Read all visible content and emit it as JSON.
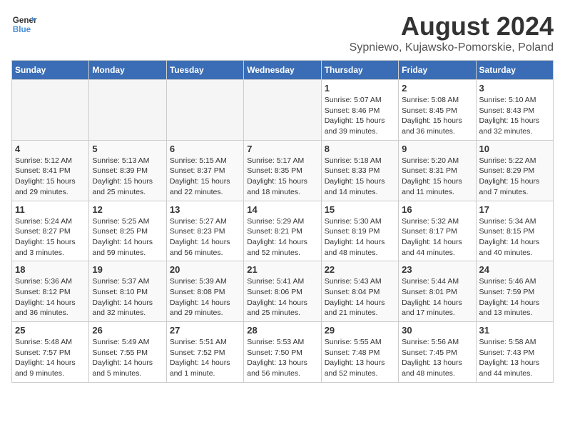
{
  "header": {
    "logo_line1": "General",
    "logo_line2": "Blue",
    "month_title": "August 2024",
    "subtitle": "Sypniewo, Kujawsko-Pomorskie, Poland"
  },
  "weekdays": [
    "Sunday",
    "Monday",
    "Tuesday",
    "Wednesday",
    "Thursday",
    "Friday",
    "Saturday"
  ],
  "weeks": [
    [
      {
        "day": "",
        "info": ""
      },
      {
        "day": "",
        "info": ""
      },
      {
        "day": "",
        "info": ""
      },
      {
        "day": "",
        "info": ""
      },
      {
        "day": "1",
        "info": "Sunrise: 5:07 AM\nSunset: 8:46 PM\nDaylight: 15 hours\nand 39 minutes."
      },
      {
        "day": "2",
        "info": "Sunrise: 5:08 AM\nSunset: 8:45 PM\nDaylight: 15 hours\nand 36 minutes."
      },
      {
        "day": "3",
        "info": "Sunrise: 5:10 AM\nSunset: 8:43 PM\nDaylight: 15 hours\nand 32 minutes."
      }
    ],
    [
      {
        "day": "4",
        "info": "Sunrise: 5:12 AM\nSunset: 8:41 PM\nDaylight: 15 hours\nand 29 minutes."
      },
      {
        "day": "5",
        "info": "Sunrise: 5:13 AM\nSunset: 8:39 PM\nDaylight: 15 hours\nand 25 minutes."
      },
      {
        "day": "6",
        "info": "Sunrise: 5:15 AM\nSunset: 8:37 PM\nDaylight: 15 hours\nand 22 minutes."
      },
      {
        "day": "7",
        "info": "Sunrise: 5:17 AM\nSunset: 8:35 PM\nDaylight: 15 hours\nand 18 minutes."
      },
      {
        "day": "8",
        "info": "Sunrise: 5:18 AM\nSunset: 8:33 PM\nDaylight: 15 hours\nand 14 minutes."
      },
      {
        "day": "9",
        "info": "Sunrise: 5:20 AM\nSunset: 8:31 PM\nDaylight: 15 hours\nand 11 minutes."
      },
      {
        "day": "10",
        "info": "Sunrise: 5:22 AM\nSunset: 8:29 PM\nDaylight: 15 hours\nand 7 minutes."
      }
    ],
    [
      {
        "day": "11",
        "info": "Sunrise: 5:24 AM\nSunset: 8:27 PM\nDaylight: 15 hours\nand 3 minutes."
      },
      {
        "day": "12",
        "info": "Sunrise: 5:25 AM\nSunset: 8:25 PM\nDaylight: 14 hours\nand 59 minutes."
      },
      {
        "day": "13",
        "info": "Sunrise: 5:27 AM\nSunset: 8:23 PM\nDaylight: 14 hours\nand 56 minutes."
      },
      {
        "day": "14",
        "info": "Sunrise: 5:29 AM\nSunset: 8:21 PM\nDaylight: 14 hours\nand 52 minutes."
      },
      {
        "day": "15",
        "info": "Sunrise: 5:30 AM\nSunset: 8:19 PM\nDaylight: 14 hours\nand 48 minutes."
      },
      {
        "day": "16",
        "info": "Sunrise: 5:32 AM\nSunset: 8:17 PM\nDaylight: 14 hours\nand 44 minutes."
      },
      {
        "day": "17",
        "info": "Sunrise: 5:34 AM\nSunset: 8:15 PM\nDaylight: 14 hours\nand 40 minutes."
      }
    ],
    [
      {
        "day": "18",
        "info": "Sunrise: 5:36 AM\nSunset: 8:12 PM\nDaylight: 14 hours\nand 36 minutes."
      },
      {
        "day": "19",
        "info": "Sunrise: 5:37 AM\nSunset: 8:10 PM\nDaylight: 14 hours\nand 32 minutes."
      },
      {
        "day": "20",
        "info": "Sunrise: 5:39 AM\nSunset: 8:08 PM\nDaylight: 14 hours\nand 29 minutes."
      },
      {
        "day": "21",
        "info": "Sunrise: 5:41 AM\nSunset: 8:06 PM\nDaylight: 14 hours\nand 25 minutes."
      },
      {
        "day": "22",
        "info": "Sunrise: 5:43 AM\nSunset: 8:04 PM\nDaylight: 14 hours\nand 21 minutes."
      },
      {
        "day": "23",
        "info": "Sunrise: 5:44 AM\nSunset: 8:01 PM\nDaylight: 14 hours\nand 17 minutes."
      },
      {
        "day": "24",
        "info": "Sunrise: 5:46 AM\nSunset: 7:59 PM\nDaylight: 14 hours\nand 13 minutes."
      }
    ],
    [
      {
        "day": "25",
        "info": "Sunrise: 5:48 AM\nSunset: 7:57 PM\nDaylight: 14 hours\nand 9 minutes."
      },
      {
        "day": "26",
        "info": "Sunrise: 5:49 AM\nSunset: 7:55 PM\nDaylight: 14 hours\nand 5 minutes."
      },
      {
        "day": "27",
        "info": "Sunrise: 5:51 AM\nSunset: 7:52 PM\nDaylight: 14 hours\nand 1 minute."
      },
      {
        "day": "28",
        "info": "Sunrise: 5:53 AM\nSunset: 7:50 PM\nDaylight: 13 hours\nand 56 minutes."
      },
      {
        "day": "29",
        "info": "Sunrise: 5:55 AM\nSunset: 7:48 PM\nDaylight: 13 hours\nand 52 minutes."
      },
      {
        "day": "30",
        "info": "Sunrise: 5:56 AM\nSunset: 7:45 PM\nDaylight: 13 hours\nand 48 minutes."
      },
      {
        "day": "31",
        "info": "Sunrise: 5:58 AM\nSunset: 7:43 PM\nDaylight: 13 hours\nand 44 minutes."
      }
    ]
  ]
}
